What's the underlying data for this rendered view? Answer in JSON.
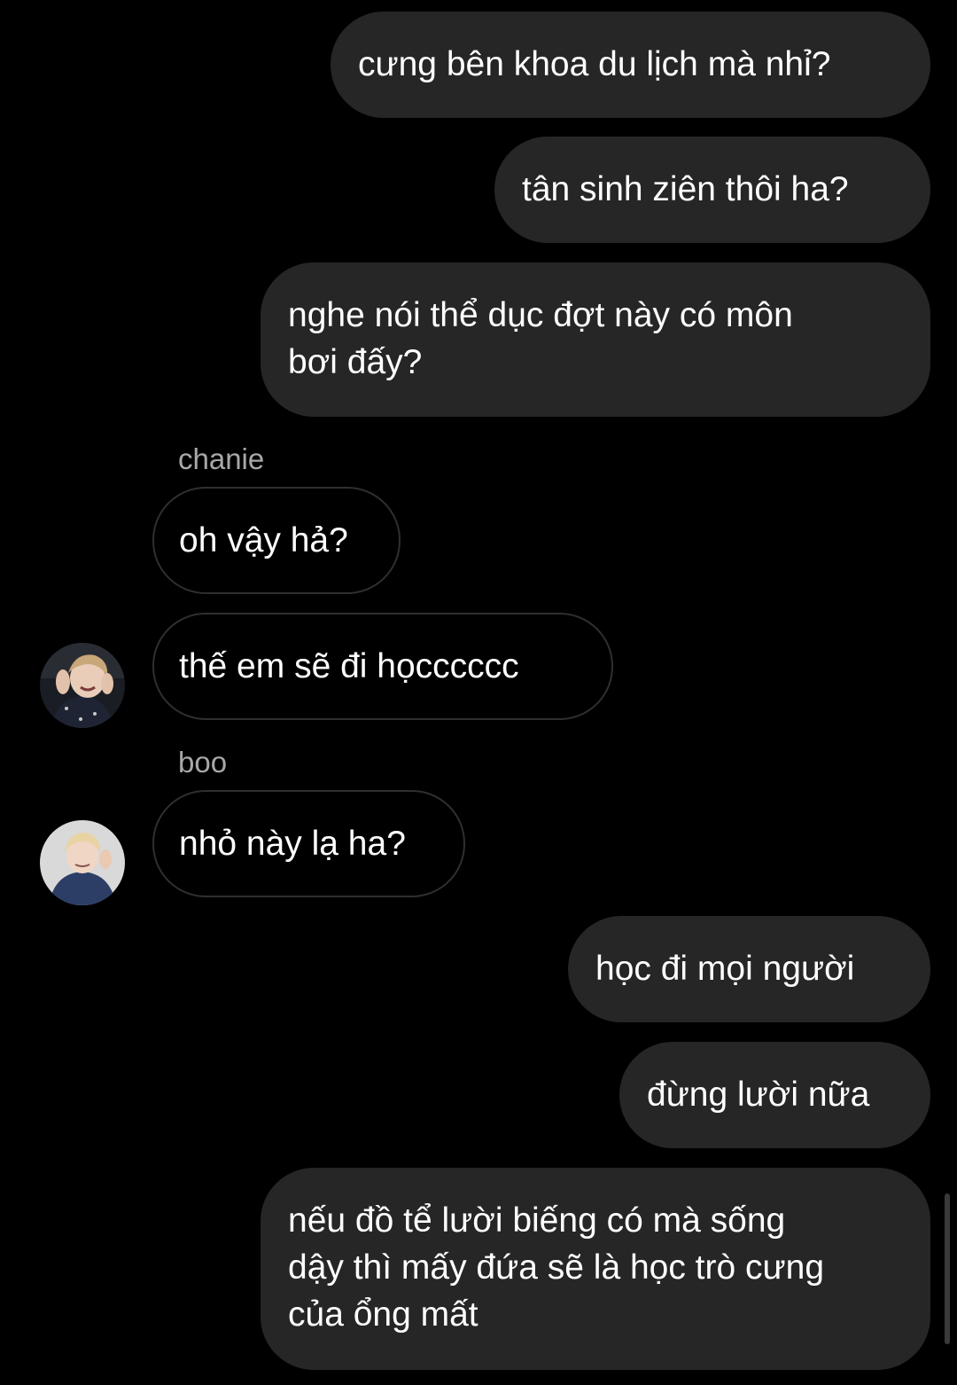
{
  "messages": {
    "m1": "cưng bên khoa du lịch mà nhỉ?",
    "m2": "tân sinh ziên thôi ha?",
    "m3_line1": "nghe nói thể dục đợt này có môn",
    "m3_line2": "bơi đấy?",
    "sender_chanie": "chanie",
    "m4": "oh vậy hả?",
    "m5": "thế em sẽ đi họcccccc",
    "sender_boo": "boo",
    "m6": "nhỏ này lạ ha?",
    "m7": "học đi mọi người",
    "m8": "đừng lười nữa",
    "m9_line1": "nếu đồ tể lười biếng có mà sống",
    "m9_line2": "dậy thì mấy đứa sẽ là học trò cưng",
    "m9_line3": "của ổng mất"
  },
  "colors": {
    "background": "#000000",
    "outgoing_bubble": "#262626",
    "incoming_border": "#2f2f2f",
    "sender_name": "#a8a8a8",
    "text": "#ffffff"
  },
  "icons": {
    "chanie_avatar": "profile-photo",
    "boo_avatar": "profile-photo"
  }
}
